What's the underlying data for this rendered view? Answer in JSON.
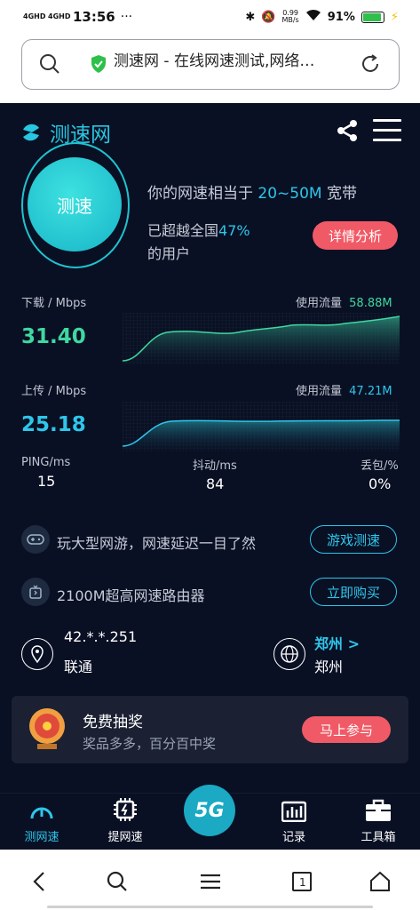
{
  "status_bar": {
    "network1": "4GHD",
    "network2": "4GHD",
    "time": "13:56",
    "more": "···",
    "speed_top": "0.99",
    "speed_unit": "MB/s",
    "battery": "91%"
  },
  "browser": {
    "page_title": "测速网 - 在线网速测试,网络…"
  },
  "header": {
    "app_name": "测速网"
  },
  "result": {
    "test_button": "测速",
    "speed_prefix": "你的网速相当于",
    "speed_range": "20~50M",
    "speed_suffix": "宽带",
    "beat_prefix": "已超越全国",
    "beat_percent": "47%",
    "beat_suffix": "的用户",
    "detail_button": "详情分析"
  },
  "download": {
    "label": "下载 / Mbps",
    "value": "31.40",
    "usage_label": "使用流量",
    "usage_value": "58.88M"
  },
  "upload": {
    "label": "上传 / Mbps",
    "value": "25.18",
    "usage_label": "使用流量",
    "usage_value": "47.21M"
  },
  "stats": {
    "ping_label": "PING/ms",
    "ping_value": "15",
    "jitter_label": "抖动/ms",
    "jitter_value": "84",
    "loss_label": "丢包/%",
    "loss_value": "0%"
  },
  "promos": [
    {
      "text": "玩大型网游，网速延迟一目了然",
      "button": "游戏测速"
    },
    {
      "text": "2100M超高网速路由器",
      "button": "立即购买"
    }
  ],
  "network": {
    "ip": "42.*.*.251",
    "isp": "联通",
    "city_link": "郑州 >",
    "city": "郑州"
  },
  "lottery": {
    "title": "免费抽奖",
    "subtitle": "奖品多多，百分百中奖",
    "button": "马上参与"
  },
  "tabs": [
    {
      "label": "测网速",
      "icon": "speedometer-icon",
      "active": true
    },
    {
      "label": "提网速",
      "icon": "chip-boost-icon",
      "active": false
    },
    {
      "label": "5G",
      "icon": "5g-icon",
      "active": false
    },
    {
      "label": "记录",
      "icon": "bar-chart-icon",
      "active": false
    },
    {
      "label": "工具箱",
      "icon": "toolbox-icon",
      "active": false
    }
  ],
  "colors": {
    "accent": "#2ec6ea",
    "green": "#3ed8a0",
    "red": "#f05a66",
    "bg": "#0a1024"
  }
}
